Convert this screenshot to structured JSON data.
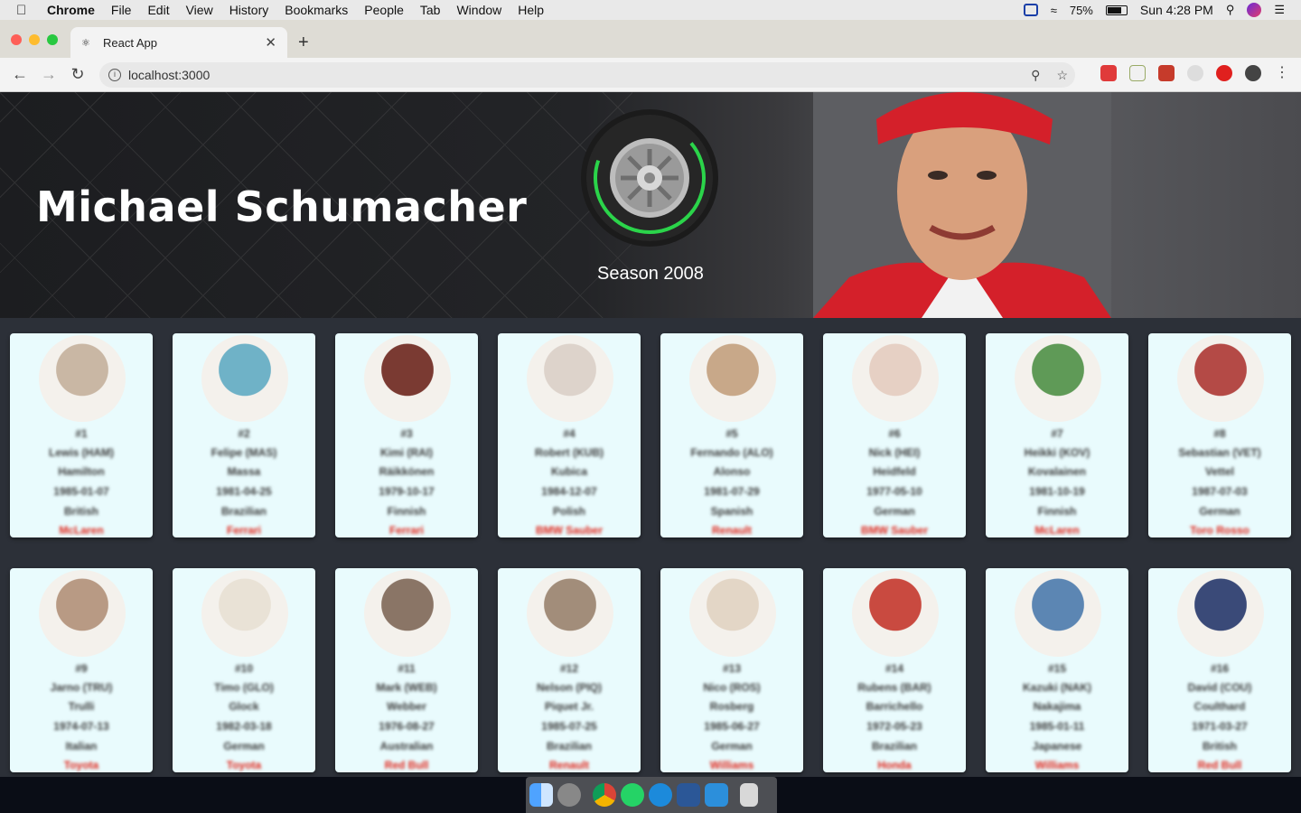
{
  "menubar": {
    "app": "Chrome",
    "items": [
      "File",
      "Edit",
      "View",
      "History",
      "Bookmarks",
      "People",
      "Tab",
      "Window",
      "Help"
    ],
    "battery": "75%",
    "clock": "Sun 4:28 PM"
  },
  "browser": {
    "tab_title": "React App",
    "url": "localhost:3000"
  },
  "hero": {
    "driver_name": "Michael Schumacher",
    "season": "Season 2008"
  },
  "drivers": [
    {
      "number": "#1",
      "name": "Lewis (HAM)",
      "surname": "Hamilton",
      "dob": "1985-01-07",
      "nationality": "British",
      "team": "McLaren",
      "photo_color": "#c9b7a4"
    },
    {
      "number": "#2",
      "name": "Felipe (MAS)",
      "surname": "Massa",
      "dob": "1981-04-25",
      "nationality": "Brazilian",
      "team": "Ferrari",
      "photo_color": "#6fb2c7"
    },
    {
      "number": "#3",
      "name": "Kimi (RAI)",
      "surname": "Räikkönen",
      "dob": "1979-10-17",
      "nationality": "Finnish",
      "team": "Ferrari",
      "photo_color": "#7a3a32"
    },
    {
      "number": "#4",
      "name": "Robert (KUB)",
      "surname": "Kubica",
      "dob": "1984-12-07",
      "nationality": "Polish",
      "team": "BMW Sauber",
      "photo_color": "#ddd3cb"
    },
    {
      "number": "#5",
      "name": "Fernando (ALO)",
      "surname": "Alonso",
      "dob": "1981-07-29",
      "nationality": "Spanish",
      "team": "Renault",
      "photo_color": "#c8a889"
    },
    {
      "number": "#6",
      "name": "Nick (HEI)",
      "surname": "Heidfeld",
      "dob": "1977-05-10",
      "nationality": "German",
      "team": "BMW Sauber",
      "photo_color": "#e6d0c4"
    },
    {
      "number": "#7",
      "name": "Heikki (KOV)",
      "surname": "Kovalainen",
      "dob": "1981-10-19",
      "nationality": "Finnish",
      "team": "McLaren",
      "photo_color": "#5f9a57"
    },
    {
      "number": "#8",
      "name": "Sebastian (VET)",
      "surname": "Vettel",
      "dob": "1987-07-03",
      "nationality": "German",
      "team": "Toro Rosso",
      "photo_color": "#b44a46"
    },
    {
      "number": "#9",
      "name": "Jarno (TRU)",
      "surname": "Trulli",
      "dob": "1974-07-13",
      "nationality": "Italian",
      "team": "Toyota",
      "photo_color": "#b89a84"
    },
    {
      "number": "#10",
      "name": "Timo (GLO)",
      "surname": "Glock",
      "dob": "1982-03-18",
      "nationality": "German",
      "team": "Toyota",
      "photo_color": "#e9e2d6"
    },
    {
      "number": "#11",
      "name": "Mark (WEB)",
      "surname": "Webber",
      "dob": "1976-08-27",
      "nationality": "Australian",
      "team": "Red Bull",
      "photo_color": "#8a7566"
    },
    {
      "number": "#12",
      "name": "Nelson (PIQ)",
      "surname": "Piquet Jr.",
      "dob": "1985-07-25",
      "nationality": "Brazilian",
      "team": "Renault",
      "photo_color": "#a28d7a"
    },
    {
      "number": "#13",
      "name": "Nico (ROS)",
      "surname": "Rosberg",
      "dob": "1985-06-27",
      "nationality": "German",
      "team": "Williams",
      "photo_color": "#e3d6c6"
    },
    {
      "number": "#14",
      "name": "Rubens (BAR)",
      "surname": "Barrichello",
      "dob": "1972-05-23",
      "nationality": "Brazilian",
      "team": "Honda",
      "photo_color": "#c94a40"
    },
    {
      "number": "#15",
      "name": "Kazuki (NAK)",
      "surname": "Nakajima",
      "dob": "1985-01-11",
      "nationality": "Japanese",
      "team": "Williams",
      "photo_color": "#5c86b3"
    },
    {
      "number": "#16",
      "name": "David (COU)",
      "surname": "Coulthard",
      "dob": "1971-03-27",
      "nationality": "British",
      "team": "Red Bull",
      "photo_color": "#3a4a78"
    }
  ],
  "dock": {
    "apps": [
      "finder-icon",
      "launchpad-icon",
      "chrome-icon",
      "whatsapp-icon",
      "teamviewer-icon",
      "word-icon",
      "vscode-icon",
      "trash-icon"
    ]
  }
}
